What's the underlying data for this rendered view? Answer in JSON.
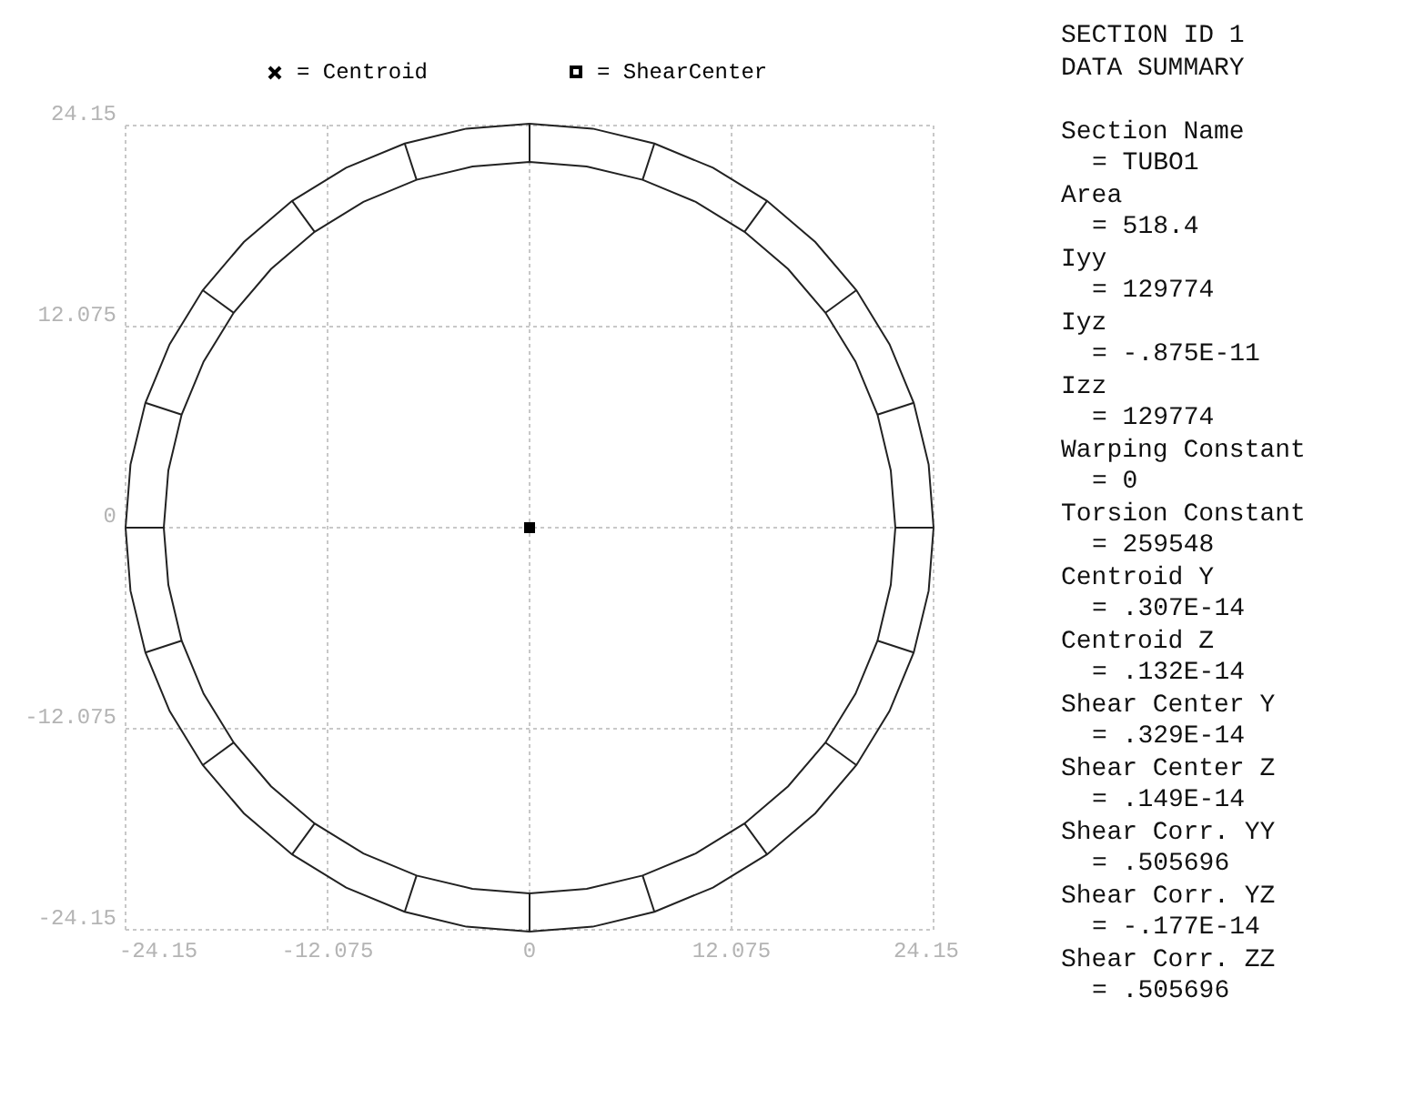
{
  "legend": [
    {
      "kind": "cross",
      "label": "= Centroid"
    },
    {
      "kind": "square",
      "label": "= ShearCenter"
    }
  ],
  "y_ticks": [
    "24.15",
    "12.075",
    "0",
    "-12.075",
    "-24.15"
  ],
  "x_ticks": [
    "-24.15",
    "-12.075",
    "0",
    "12.075",
    "24.15"
  ],
  "summary": {
    "title": [
      "SECTION ID 1",
      "DATA SUMMARY"
    ],
    "fields": [
      {
        "label": "Section Name",
        "value": "= TUBO1"
      },
      {
        "label": "Area",
        "value": "= 518.4"
      },
      {
        "label": "Iyy",
        "value": "= 129774"
      },
      {
        "label": "Iyz",
        "value": "= -.875E-11"
      },
      {
        "label": "Izz",
        "value": "= 129774"
      },
      {
        "label": "Warping Constant",
        "value": "= 0"
      },
      {
        "label": "Torsion Constant",
        "value": "= 259548"
      },
      {
        "label": "Centroid Y",
        "value": "= .307E-14"
      },
      {
        "label": "Centroid Z",
        "value": "= .132E-14"
      },
      {
        "label": "Shear Center Y",
        "value": "= .329E-14"
      },
      {
        "label": "Shear Center Z",
        "value": "= .149E-14"
      },
      {
        "label": "Shear Corr. YY",
        "value": "= .505696"
      },
      {
        "label": "Shear Corr. YZ",
        "value": "= -.177E-14"
      },
      {
        "label": "Shear Corr. ZZ",
        "value": "= .505696"
      }
    ]
  }
}
